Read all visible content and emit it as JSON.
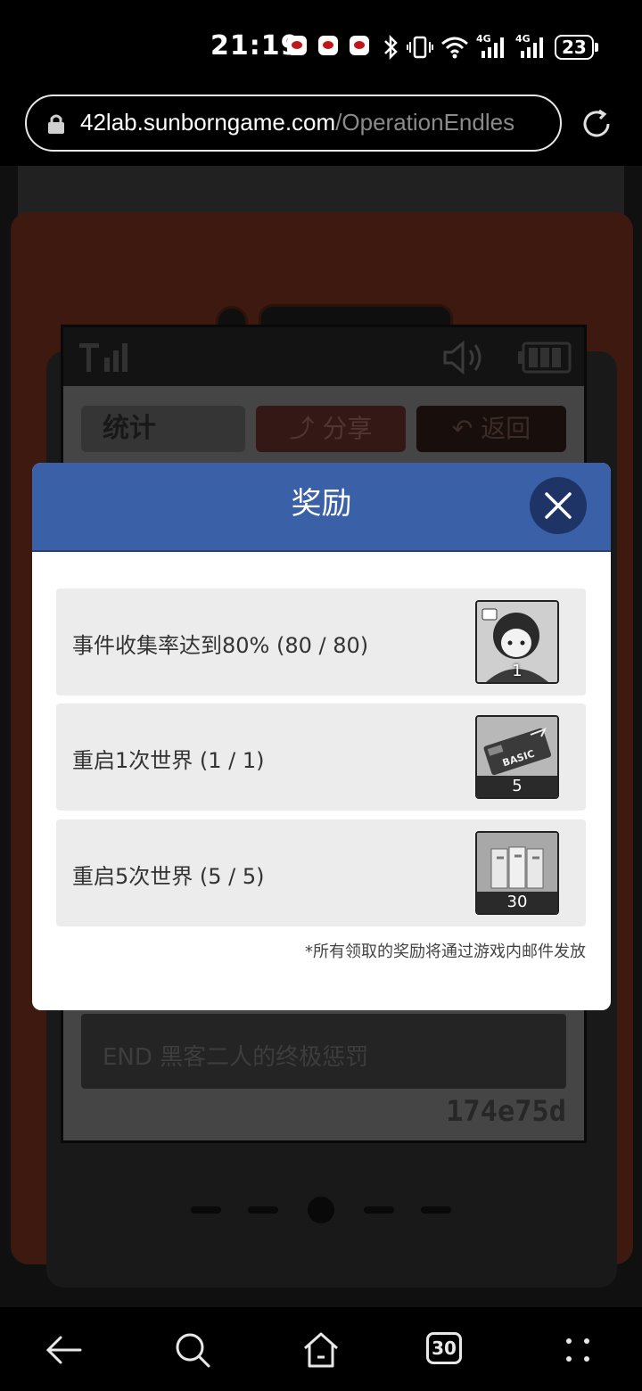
{
  "status_bar": {
    "time": "21:19",
    "signal_label_1": "4G",
    "signal_label_2": "4G",
    "battery": "23"
  },
  "browser": {
    "url_domain": "42lab.sunborngame.com",
    "url_path": "/OperationEndles"
  },
  "game_screen": {
    "tab_stats": "统计",
    "tab_share": "分享",
    "tab_back": "返回",
    "ending_title": "END 黑客二人的终极惩罚",
    "code": "174e75d"
  },
  "dialog": {
    "title": "奖励",
    "rewards": [
      {
        "label": "事件收集率达到80% (80 / 80)",
        "count": "1"
      },
      {
        "label": "重启1次世界 (1 / 1)",
        "count": "5",
        "item_text": "BASIC"
      },
      {
        "label": "重启5次世界 (5 / 5)",
        "count": "30"
      }
    ],
    "footnote": "*所有领取的奖励将通过游戏内邮件发放"
  },
  "nav_bar": {
    "tabs_count": "30"
  }
}
